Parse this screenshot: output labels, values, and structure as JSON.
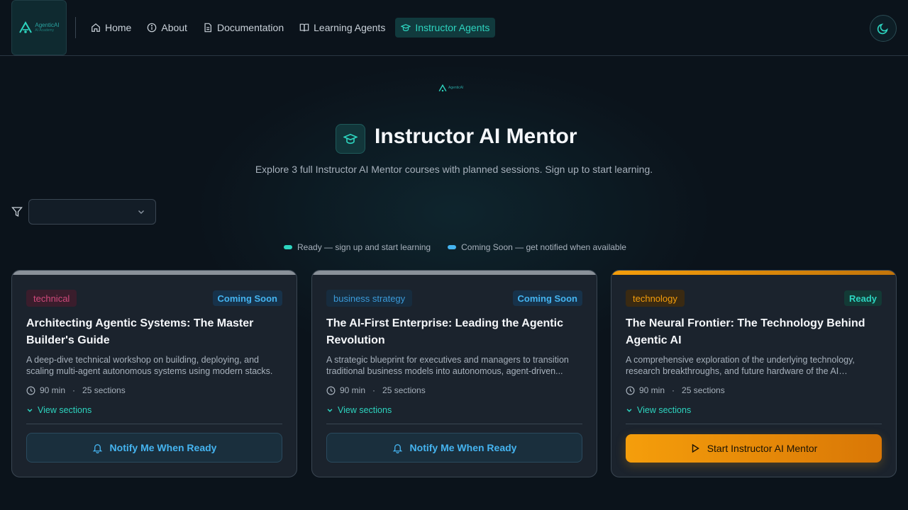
{
  "nav": {
    "logo": {
      "name": "AgenticAI",
      "tagline": "AI Academy"
    },
    "links": [
      {
        "label": "Home",
        "icon": "home-icon"
      },
      {
        "label": "About",
        "icon": "info-icon"
      },
      {
        "label": "Documentation",
        "icon": "document-icon"
      },
      {
        "label": "Learning Agents",
        "icon": "book-icon"
      },
      {
        "label": "Instructor Agents",
        "icon": "graduation-cap-icon",
        "active": true
      }
    ],
    "theme_toggle_icon": "moon-icon"
  },
  "hero": {
    "title": "Instructor AI Mentor",
    "subtitle": "Explore 3 full Instructor AI Mentor courses with planned sessions. Sign up to start learning."
  },
  "filter": {
    "value": ""
  },
  "legend": {
    "ready": "Ready — sign up and start learning",
    "coming_soon": "Coming Soon — get notified when available"
  },
  "colors": {
    "accent": "#2dd4bf",
    "coming_soon": "#45b4f0",
    "ready_bar": "#f59e0b",
    "technical_tag": "#d04a7c",
    "business_tag": "#3b9ad9",
    "technology_tag": "#f59e0b"
  },
  "cards": [
    {
      "tag": "technical",
      "status": "Coming Soon",
      "title": "Architecting Agentic Systems: The Master Builder's Guide",
      "description": "A deep-dive technical workshop on building, deploying, and scaling multi-agent autonomous systems using modern stacks.",
      "duration": "90 min",
      "sections": "25 sections",
      "view_sections": "View sections",
      "action": "Notify Me When Ready"
    },
    {
      "tag": "business strategy",
      "status": "Coming Soon",
      "title": "The AI-First Enterprise: Leading the Agentic Revolution",
      "description": "A strategic blueprint for executives and managers to transition traditional business models into autonomous, agent-driven...",
      "duration": "90 min",
      "sections": "25 sections",
      "view_sections": "View sections",
      "action": "Notify Me When Ready"
    },
    {
      "tag": "technology",
      "status": "Ready",
      "title": "The Neural Frontier: The Technology Behind Agentic AI",
      "description": "A comprehensive exploration of the underlying technology, research breakthroughs, and future hardware of the AI ecosystem.",
      "duration": "90 min",
      "sections": "25 sections",
      "view_sections": "View sections",
      "action": "Start Instructor AI Mentor"
    }
  ]
}
